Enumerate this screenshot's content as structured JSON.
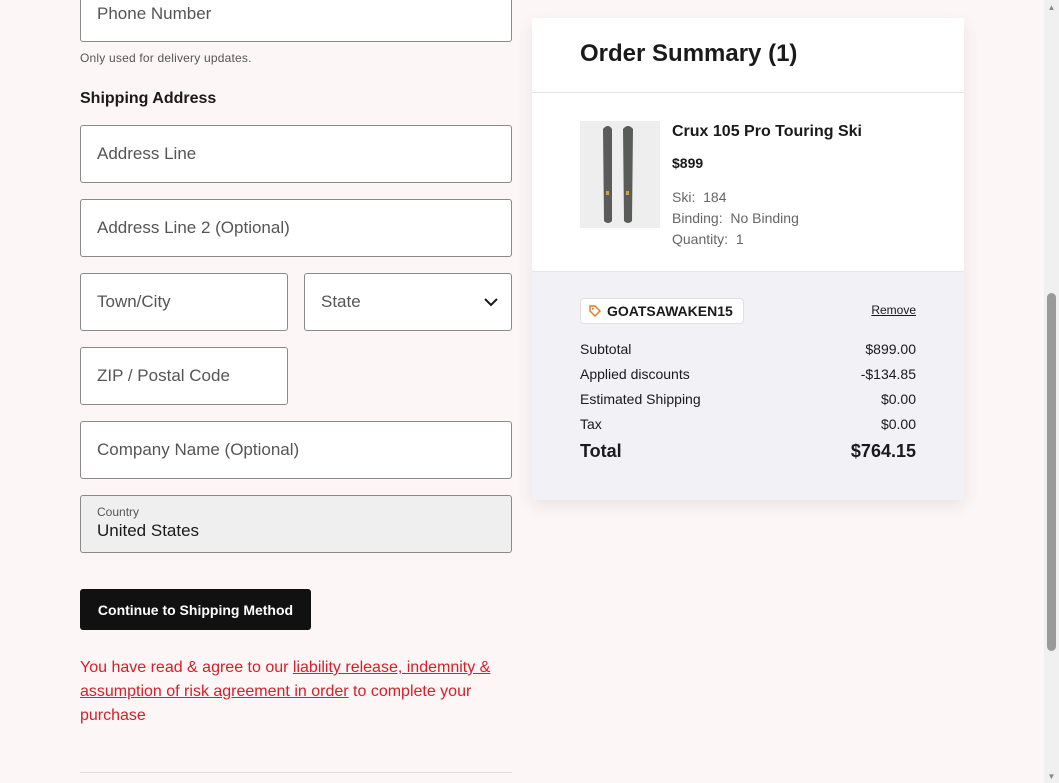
{
  "form": {
    "phone_placeholder": "Phone Number",
    "phone_helper": "Only used for delivery updates.",
    "shipping_title": "Shipping Address",
    "address1_placeholder": "Address Line",
    "address2_placeholder": "Address Line 2 (Optional)",
    "city_placeholder": "Town/City",
    "state_placeholder": "State",
    "zip_placeholder": "ZIP / Postal Code",
    "company_placeholder": "Company Name (Optional)",
    "country_label": "Country",
    "country_value": "United States",
    "continue_button": "Continue to Shipping Method",
    "legal_prefix": "You have read & agree to our ",
    "legal_link": "liability release, indemnity & assumption of risk agreement in order",
    "legal_suffix": " to complete your purchase"
  },
  "summary": {
    "title": "Order Summary (1)",
    "item": {
      "name": "Crux 105 Pro Touring Ski",
      "price": "$899",
      "ski_label": "Ski:",
      "ski_value": "184",
      "binding_label": "Binding:",
      "binding_value": "No Binding",
      "quantity_label": "Quantity:",
      "quantity_value": "1"
    },
    "coupon_code": "GOATSAWAKEN15",
    "remove_label": "Remove",
    "rows": [
      {
        "label": "Subtotal",
        "value": "$899.00"
      },
      {
        "label": "Applied discounts",
        "value": "-$134.85"
      },
      {
        "label": "Estimated Shipping",
        "value": "$0.00"
      },
      {
        "label": "Tax",
        "value": "$0.00"
      }
    ],
    "total_label": "Total",
    "total_value": "$764.15"
  },
  "colors": {
    "accent_red": "#d3202a",
    "button_bg": "#111111",
    "page_bg": "#fdf6f6"
  }
}
